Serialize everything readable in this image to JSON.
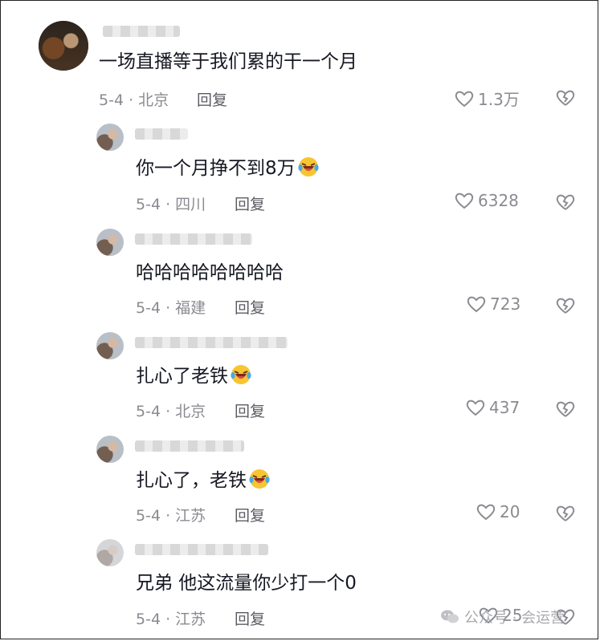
{
  "comments": [
    {
      "text": "一场直播等于我们累的干一个月",
      "meta": "5-4 · 北京",
      "reply": "回复",
      "likes": "1.3万",
      "emoji": false
    },
    {
      "text": "你一个月挣不到8万",
      "meta": "5-4 · 四川",
      "reply": "回复",
      "likes": "6328",
      "emoji": true
    },
    {
      "text": "哈哈哈哈哈哈哈哈",
      "meta": "5-4 · 福建",
      "reply": "回复",
      "likes": "723",
      "emoji": false
    },
    {
      "text": "扎心了老铁",
      "meta": "5-4 · 北京",
      "reply": "回复",
      "likes": "437",
      "emoji": true
    },
    {
      "text": "扎心了，老铁",
      "meta": "5-4 · 江苏",
      "reply": "回复",
      "likes": "20",
      "emoji": true
    },
    {
      "text": "兄弟 他这流量你少打一个0",
      "meta": "5-4 · 江苏",
      "reply": "回复",
      "likes": "25",
      "emoji": false
    }
  ],
  "watermark": {
    "text": "公众号 · 会运营"
  },
  "icons": {
    "like": "heart-outline-icon",
    "dislike": "broken-heart-icon",
    "emoji": "laughing-crying-emoji"
  }
}
